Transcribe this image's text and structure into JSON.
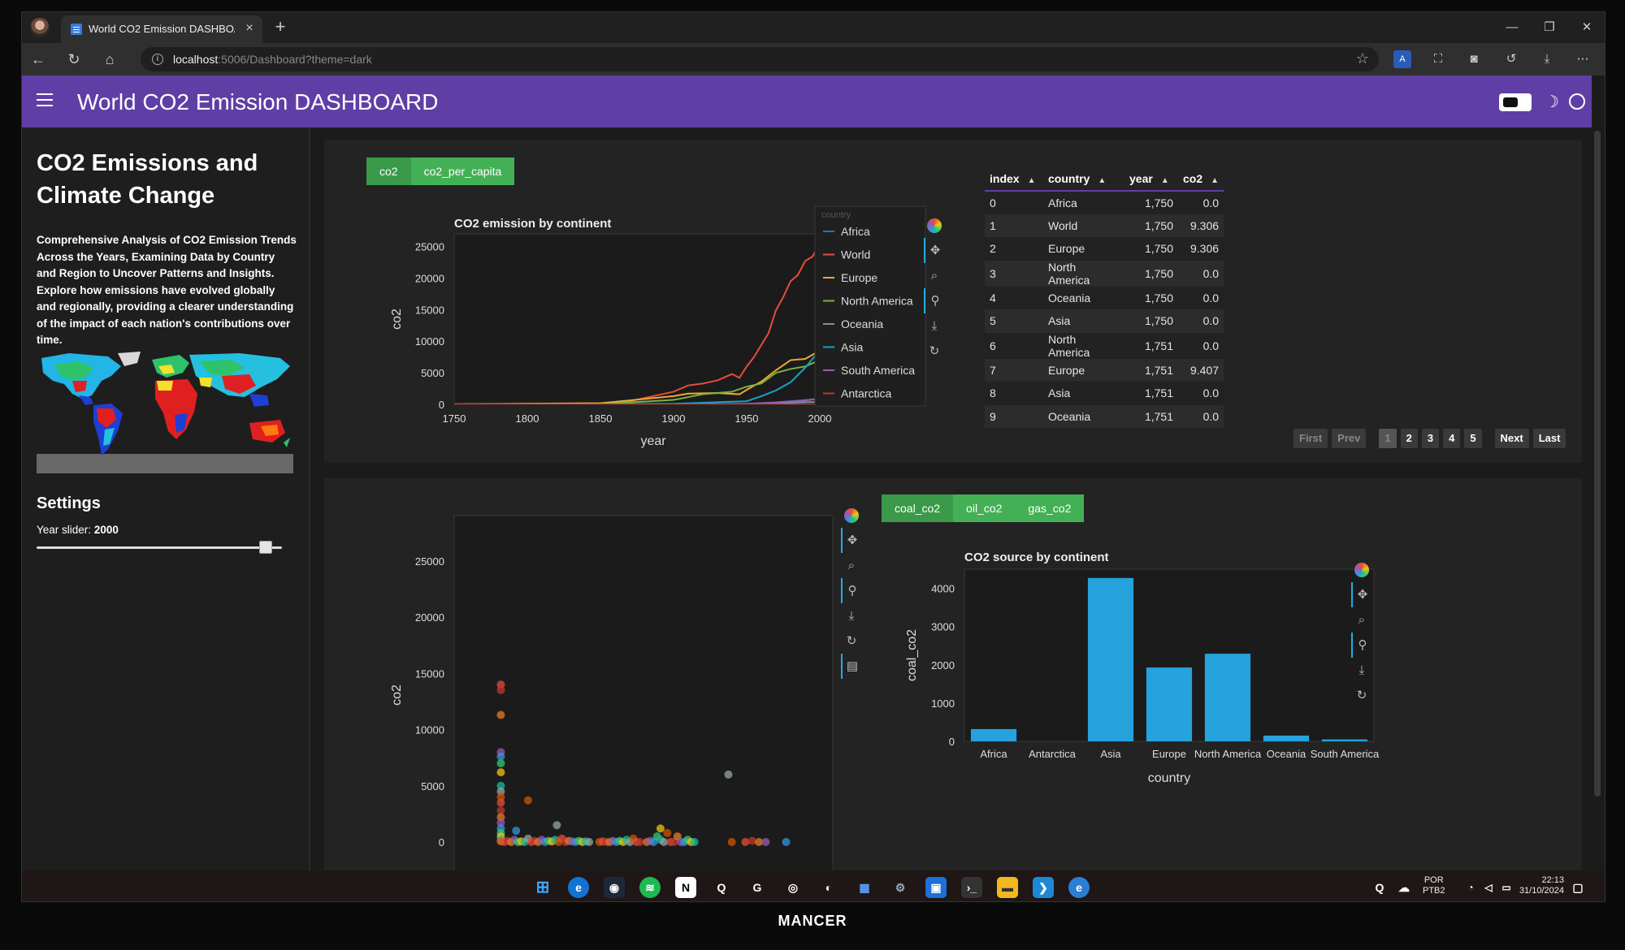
{
  "browser": {
    "tab_title": "World CO2 Emission DASHBOARD",
    "url_host": "localhost",
    "url_path": ":5006/Dashboard?theme=dark"
  },
  "app": {
    "title": "World CO2 Emission DASHBOARD"
  },
  "sidebar": {
    "heading": "CO2 Emissions and Climate Change",
    "description": "Comprehensive Analysis of CO2 Emission Trends Across the Years, Examining Data by Country and Region to Uncover Patterns and Insights. Explore how emissions have evolved globally and regionally, providing a clearer understanding of the impact of each nation's contributions over time.",
    "settings_heading": "Settings",
    "slider_label": "Year slider:",
    "slider_value": "2000",
    "slider_fraction": 0.93
  },
  "line_panel": {
    "buttons": [
      "co2",
      "co2_per_capita"
    ],
    "active_button": "co2"
  },
  "table": {
    "columns": [
      "index",
      "country",
      "year",
      "co2"
    ],
    "rows": [
      [
        "0",
        "Africa",
        "1,750",
        "0.0"
      ],
      [
        "1",
        "World",
        "1,750",
        "9.306"
      ],
      [
        "2",
        "Europe",
        "1,750",
        "9.306"
      ],
      [
        "3",
        "North America",
        "1,750",
        "0.0"
      ],
      [
        "4",
        "Oceania",
        "1,750",
        "0.0"
      ],
      [
        "5",
        "Asia",
        "1,750",
        "0.0"
      ],
      [
        "6",
        "North America",
        "1,751",
        "0.0"
      ],
      [
        "7",
        "Europe",
        "1,751",
        "9.407"
      ],
      [
        "8",
        "Asia",
        "1,751",
        "0.0"
      ],
      [
        "9",
        "Oceania",
        "1,751",
        "0.0"
      ]
    ],
    "pager": {
      "first": "First",
      "prev": "Prev",
      "pages": [
        "1",
        "2",
        "3",
        "4",
        "5"
      ],
      "next": "Next",
      "last": "Last",
      "current": "1"
    }
  },
  "bar_panel": {
    "buttons": [
      "coal_co2",
      "oil_co2",
      "gas_co2"
    ],
    "active_button": "coal_co2"
  },
  "taskbar": {
    "lang": "POR",
    "layout": "PTB2",
    "time": "22:13",
    "date": "31/10/2024"
  },
  "brand": "MANCER",
  "chart_data": [
    {
      "type": "line",
      "title": "CO2 emission by continent",
      "xlabel": "year",
      "ylabel": "co2",
      "xlim": [
        1750,
        2000
      ],
      "ylim": [
        0,
        27000
      ],
      "xticks": [
        1750,
        1800,
        1850,
        1900,
        1950,
        2000
      ],
      "yticks": [
        0,
        5000,
        10000,
        15000,
        20000,
        25000
      ],
      "legend_title": "country",
      "legend_position": "right",
      "series": [
        {
          "name": "Africa",
          "color": "#1f77b4",
          "x": [
            1750,
            1850,
            1900,
            1950,
            1970,
            1990,
            2000
          ],
          "y": [
            0,
            0,
            5,
            60,
            310,
            690,
            880
          ]
        },
        {
          "name": "World",
          "color": "#e74c3c",
          "x": [
            1750,
            1850,
            1870,
            1900,
            1910,
            1920,
            1930,
            1940,
            1945,
            1950,
            1955,
            1960,
            1965,
            1970,
            1975,
            1980,
            1985,
            1990,
            1995,
            2000
          ],
          "y": [
            9,
            200,
            500,
            2000,
            3000,
            3300,
            3800,
            4800,
            4200,
            6000,
            7500,
            9400,
            11300,
            14900,
            17000,
            19500,
            20500,
            22700,
            23400,
            25500
          ]
        },
        {
          "name": "Europe",
          "color": "#f0a830",
          "x": [
            1750,
            1850,
            1900,
            1910,
            1930,
            1945,
            1950,
            1960,
            1970,
            1980,
            1990,
            2000
          ],
          "y": [
            9,
            180,
            1300,
            1700,
            1800,
            1600,
            2300,
            3600,
            5400,
            7000,
            7200,
            8500
          ]
        },
        {
          "name": "North America",
          "color": "#7cb342",
          "x": [
            1750,
            1850,
            1900,
            1920,
            1940,
            1950,
            1960,
            1970,
            1980,
            1990,
            2000
          ],
          "y": [
            0,
            30,
            700,
            1600,
            2000,
            2800,
            3300,
            5000,
            5600,
            6000,
            7000
          ]
        },
        {
          "name": "Oceania",
          "color": "#8d8d8d",
          "x": [
            1750,
            1900,
            1950,
            2000
          ],
          "y": [
            0,
            10,
            70,
            400
          ]
        },
        {
          "name": "Asia",
          "color": "#17a2c8",
          "x": [
            1750,
            1850,
            1900,
            1950,
            1960,
            1970,
            1980,
            1990,
            2000
          ],
          "y": [
            0,
            10,
            100,
            500,
            1300,
            2200,
            3500,
            5800,
            8600
          ]
        },
        {
          "name": "South America",
          "color": "#9b59b6",
          "x": [
            1750,
            1900,
            1950,
            1970,
            1990,
            2000
          ],
          "y": [
            0,
            10,
            100,
            300,
            600,
            900
          ]
        },
        {
          "name": "Antarctica",
          "color": "#c0392b",
          "x": [
            1750,
            2000
          ],
          "y": [
            0,
            0
          ]
        }
      ]
    },
    {
      "type": "scatter",
      "ylabel": "co2",
      "ylim": [
        0,
        27000
      ],
      "yticks": [
        0,
        5000,
        10000,
        15000,
        20000,
        25000
      ],
      "xlim": [
        0,
        100
      ],
      "points": [
        [
          8,
          14000
        ],
        [
          8,
          13500
        ],
        [
          8,
          11300
        ],
        [
          8,
          8000
        ],
        [
          8,
          7600
        ],
        [
          8,
          7000
        ],
        [
          8,
          6200
        ],
        [
          8,
          5000
        ],
        [
          8,
          4500
        ],
        [
          8,
          4000
        ],
        [
          8,
          3500
        ],
        [
          8,
          2800
        ],
        [
          8,
          2200
        ],
        [
          8,
          1700
        ],
        [
          8,
          1200
        ],
        [
          8,
          800
        ],
        [
          8,
          500
        ],
        [
          8,
          200
        ],
        [
          8,
          100
        ],
        [
          8,
          50
        ],
        [
          9,
          0
        ],
        [
          10,
          100
        ],
        [
          11,
          0
        ],
        [
          12,
          200
        ],
        [
          12.5,
          1000
        ],
        [
          13,
          0
        ],
        [
          14,
          50
        ],
        [
          15,
          0
        ],
        [
          16,
          300
        ],
        [
          16,
          3700
        ],
        [
          17,
          0
        ],
        [
          18,
          100
        ],
        [
          19,
          0
        ],
        [
          20,
          200
        ],
        [
          21,
          0
        ],
        [
          22,
          100
        ],
        [
          23,
          50
        ],
        [
          24,
          200
        ],
        [
          24.5,
          1500
        ],
        [
          25,
          0
        ],
        [
          26,
          300
        ],
        [
          27,
          0
        ],
        [
          28,
          100
        ],
        [
          29,
          50
        ],
        [
          30,
          0
        ],
        [
          31,
          100
        ],
        [
          32,
          0
        ],
        [
          33,
          50
        ],
        [
          34,
          0
        ],
        [
          37,
          0
        ],
        [
          38,
          50
        ],
        [
          39,
          0
        ],
        [
          40,
          0
        ],
        [
          41,
          100
        ],
        [
          42,
          0
        ],
        [
          43,
          100
        ],
        [
          44,
          0
        ],
        [
          45,
          200
        ],
        [
          46,
          0
        ],
        [
          47,
          300
        ],
        [
          48,
          0
        ],
        [
          49,
          0
        ],
        [
          51,
          0
        ],
        [
          52,
          100
        ],
        [
          53,
          0
        ],
        [
          54,
          500
        ],
        [
          55,
          1200
        ],
        [
          55,
          200
        ],
        [
          56,
          0
        ],
        [
          57,
          800
        ],
        [
          58,
          0
        ],
        [
          59,
          0
        ],
        [
          60,
          500
        ],
        [
          61,
          0
        ],
        [
          62,
          0
        ],
        [
          63,
          200
        ],
        [
          64,
          0
        ],
        [
          65,
          0
        ],
        [
          75,
          6000
        ],
        [
          76,
          0
        ],
        [
          80,
          0
        ],
        [
          82,
          100
        ],
        [
          84,
          0
        ],
        [
          86,
          0
        ],
        [
          92,
          0
        ]
      ],
      "colors": [
        "#e74c3c",
        "#c0392b",
        "#e67e22",
        "#9b59b6",
        "#3498db",
        "#2ecc71",
        "#f1c40f",
        "#1abc9c",
        "#95a5a6",
        "#d35400"
      ]
    },
    {
      "type": "bar",
      "title": "CO2 source by continent",
      "xlabel": "country",
      "ylabel": "coal_co2",
      "categories": [
        "Africa",
        "Antarctica",
        "Asia",
        "Europe",
        "North America",
        "Oceania",
        "South America"
      ],
      "values": [
        320,
        0,
        4270,
        1930,
        2290,
        150,
        50
      ],
      "ylim": [
        0,
        4500
      ],
      "yticks": [
        0,
        1000,
        2000,
        3000,
        4000
      ],
      "color": "#26a2dc"
    }
  ]
}
